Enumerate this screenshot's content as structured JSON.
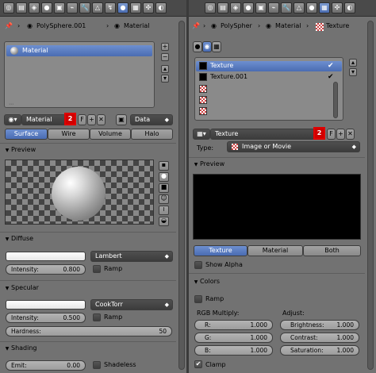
{
  "left": {
    "breadcrumb": {
      "object": "PolySphere.001",
      "material": "Material"
    },
    "slot_item": "Material",
    "datablock": {
      "name": "Material",
      "users": "2",
      "fake_user": "F",
      "link": "Data"
    },
    "tabs": [
      "Surface",
      "Wire",
      "Volume",
      "Halo"
    ],
    "preview_title": "Preview",
    "diffuse": {
      "title": "Diffuse",
      "shader": "Lambert",
      "intensity_label": "Intensity:",
      "intensity": "0.800",
      "ramp": "Ramp",
      "color": "#f2f2f2"
    },
    "specular": {
      "title": "Specular",
      "shader": "CookTorr",
      "intensity_label": "Intensity:",
      "intensity": "0.500",
      "ramp": "Ramp",
      "hardness_label": "Hardness:",
      "hardness": "50",
      "color": "#ffffff"
    },
    "shading": {
      "title": "Shading",
      "emit_label": "Emit:",
      "emit": "0.00",
      "shadeless": "Shadeless"
    }
  },
  "right": {
    "breadcrumb": {
      "object": "PolySpher",
      "material": "Material",
      "texture": "Texture"
    },
    "slots": [
      "Texture",
      "Texture.001",
      "",
      "",
      "",
      ""
    ],
    "datablock": {
      "name": "Texture",
      "users": "2",
      "fake_user": "F"
    },
    "type_label": "Type:",
    "type_value": "Image or Movie",
    "preview_title": "Preview",
    "preview_tabs": [
      "Texture",
      "Material",
      "Both"
    ],
    "show_alpha": "Show Alpha",
    "colors": {
      "title": "Colors",
      "ramp": "Ramp",
      "rgb_title": "RGB Multiply:",
      "adjust_title": "Adjust:",
      "r_label": "R:",
      "r": "1.000",
      "g_label": "G:",
      "g": "1.000",
      "b_label": "B:",
      "b": "1.000",
      "brightness_label": "Brightness:",
      "brightness": "1.000",
      "contrast_label": "Contrast:",
      "contrast": "1.000",
      "saturation_label": "Saturation:",
      "saturation": "1.000",
      "clamp": "Clamp"
    }
  },
  "colors": {
    "accent": "#5680c2",
    "badge": "#d00000",
    "panel": "#727272"
  }
}
